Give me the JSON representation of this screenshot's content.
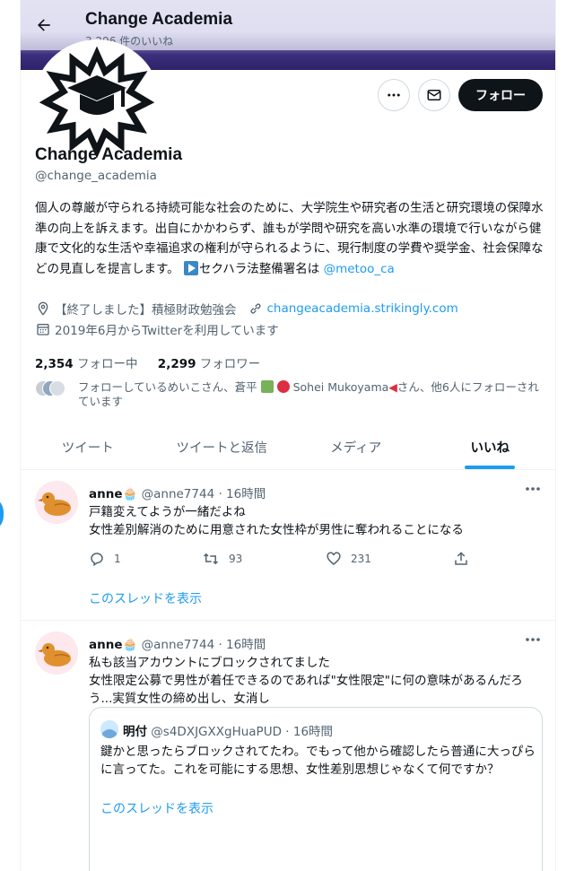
{
  "header": {
    "title": "Change Academia",
    "likes_count": "3,296 件のいいね"
  },
  "profile": {
    "name": "Change Academia",
    "handle": "@change_academia",
    "bio_text": "個人の尊厳が守られる持続可能な社会のために、大学院生や研究者の生活と研究環境の保障水準の向上を訴えます。出自にかかわらず、誰もが学問や研究を高い水準の環境で行いながら健康で文化的な生活や幸福追求の権利が守られるように、現行制度の学費や奨学金、社会保障などの見直しを提言します。",
    "bio_tail": "セクハラ法整備署名は",
    "bio_link": "@metoo_ca",
    "location": "【終了しました】積極財政勉強会",
    "website": "changeacademia.strikingly.com",
    "joined": "2019年6月からTwitterを利用しています",
    "following_count": "2,354",
    "following_label": "フォロー中",
    "followers_count": "2,299",
    "followers_label": "フォロワー",
    "known_followers_a": "フォローしているめいこさん、蒼平",
    "known_followers_b": "Sohei Mukoyama",
    "known_followers_c": "さん、他6人にフォローされています",
    "follow_label": "フォロー"
  },
  "tabs": [
    {
      "label": "ツイート"
    },
    {
      "label": "ツイートと返信"
    },
    {
      "label": "メディア"
    },
    {
      "label": "いいね"
    }
  ],
  "tweets": [
    {
      "name": "anne",
      "handle": "@anne7744",
      "time": "16時間",
      "line1": "戸籍変えてようが一緒だよね",
      "line2": "女性差別解消のために用意された女性枠が男性に奪われることになる",
      "replies": "1",
      "retweets": "93",
      "likes": "231",
      "show_thread": "このスレッドを表示"
    },
    {
      "name": "anne",
      "handle": "@anne7744",
      "time": "16時間",
      "line1": "私も該当アカウントにブロックされてました",
      "line2": "女性限定公募で男性が着任できるのであれば\"女性限定\"に何の意味があるんだろう...実質女性の締め出し、女消し",
      "quote": {
        "name": "明付",
        "handle": "@s4DXJGXXgHuaPUD",
        "time": "16時間",
        "body": "鍵かと思ったらブロックされてたわ。でもって他から確認したら普通に大っぴらに言ってた。これを可能にする思想、女性差別思想じゃなくて何ですか？",
        "show_thread": "このスレッドを表示"
      }
    }
  ],
  "colors": {
    "accent": "#1d9bf0",
    "text": "#0f1419",
    "muted": "#536471",
    "banner_dark": "#2e226a"
  }
}
